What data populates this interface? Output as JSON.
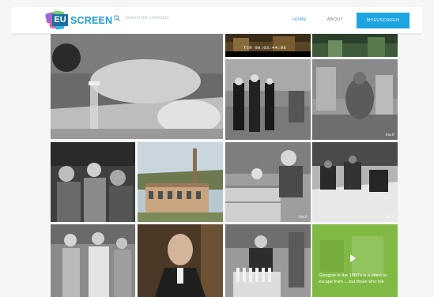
{
  "header": {
    "logo_mark": "EU",
    "logo_text": "SCREEN",
    "search_placeholder": "Search the collection",
    "nav": {
      "home": "HOME",
      "about": "ABOUT",
      "my": "MYEUSCREEN"
    }
  },
  "grid": {
    "timecode": "TCR 00:03:44:06",
    "watermark": "Ina.fr",
    "caption": "Glasgow in the 1960's is a place to escape from ... but those who trie"
  },
  "colors": {
    "accent": "#1ca5e1",
    "tile_green": "#79b43c"
  },
  "icons": [
    "search-icon",
    "play-icon"
  ]
}
